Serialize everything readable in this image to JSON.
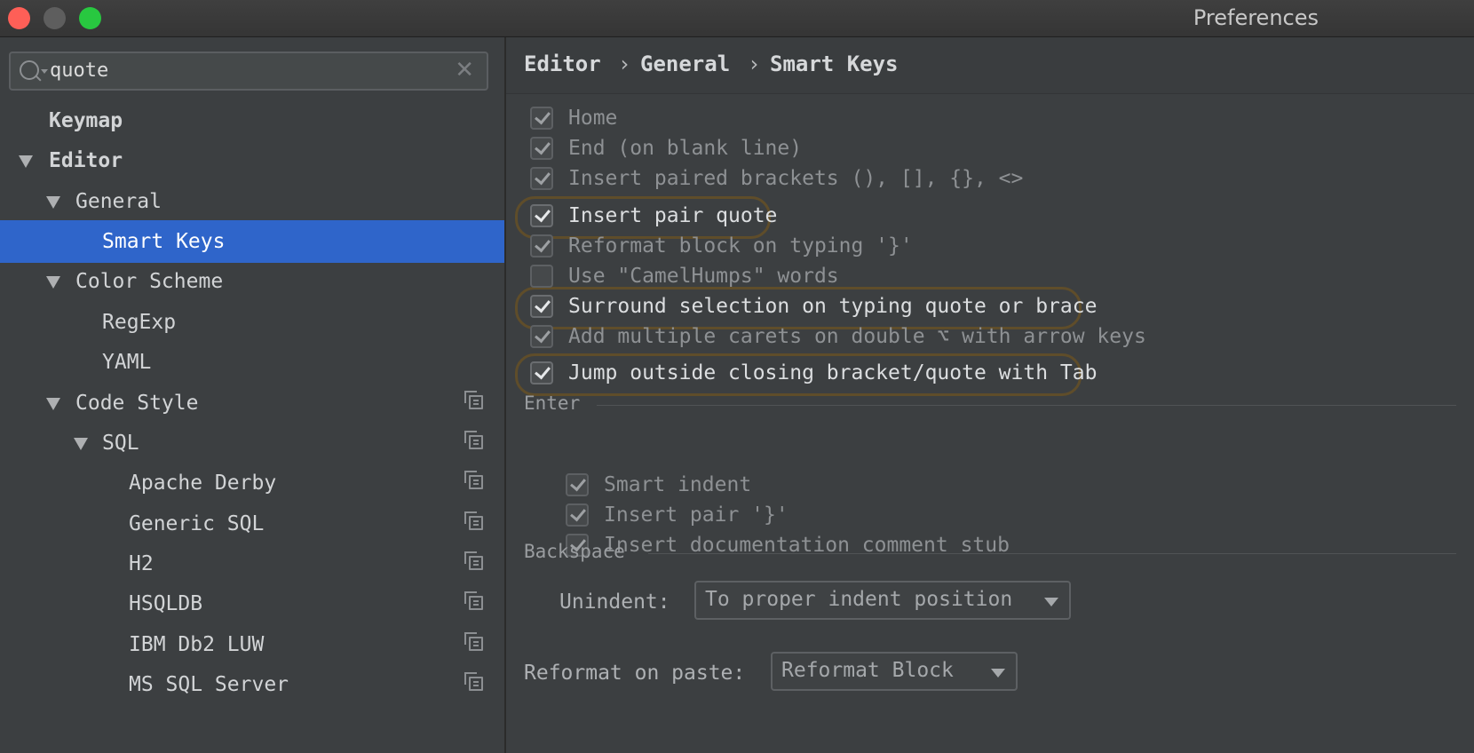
{
  "window": {
    "title": "Preferences"
  },
  "search": {
    "value": "quote",
    "clear_icon": "clear-icon",
    "icon": "search-icon"
  },
  "sidebar": {
    "items": [
      {
        "label": "Keymap"
      },
      {
        "label": "Editor"
      },
      {
        "label": "General"
      },
      {
        "label": "Smart Keys"
      },
      {
        "label": "Color Scheme"
      },
      {
        "label": "RegExp"
      },
      {
        "label": "YAML"
      },
      {
        "label": "Code Style"
      },
      {
        "label": "SQL"
      },
      {
        "label": "Apache Derby"
      },
      {
        "label": "Generic SQL"
      },
      {
        "label": "H2"
      },
      {
        "label": "HSQLDB"
      },
      {
        "label": "IBM Db2 LUW"
      },
      {
        "label": "MS SQL Server"
      }
    ]
  },
  "breadcrumb": {
    "items": [
      "Editor",
      "General",
      "Smart Keys"
    ],
    "separator": "›"
  },
  "options": [
    {
      "label": "Home",
      "checked": true
    },
    {
      "label": "End (on blank line)",
      "checked": true
    },
    {
      "label": "Insert paired brackets (), [], {}, <>",
      "checked": true
    },
    {
      "label": "Insert pair quote",
      "checked": true
    },
    {
      "label": "Reformat block on typing '}'",
      "checked": true
    },
    {
      "label": "Use \"CamelHumps\" words",
      "checked": false
    },
    {
      "label": "Surround selection on typing quote or brace",
      "checked": true
    },
    {
      "label": "Add multiple carets on double ⌥ with arrow keys",
      "checked": true
    },
    {
      "label": "Jump outside closing bracket/quote with Tab",
      "checked": true
    }
  ],
  "enter": {
    "title": "Enter",
    "options": [
      {
        "label": "Smart indent",
        "checked": true
      },
      {
        "label": "Insert pair '}'",
        "checked": true
      },
      {
        "label": "Insert documentation comment stub",
        "checked": true
      }
    ]
  },
  "backspace": {
    "title": "Backspace",
    "unindent_label": "Unindent:",
    "unindent_value": "To proper indent position",
    "reformat_label": "Reformat on paste:",
    "reformat_value": "Reformat Block"
  },
  "colors": {
    "selection": "#2f65ca",
    "highlight": "#5f4d2a",
    "background": "#3c3f41"
  }
}
